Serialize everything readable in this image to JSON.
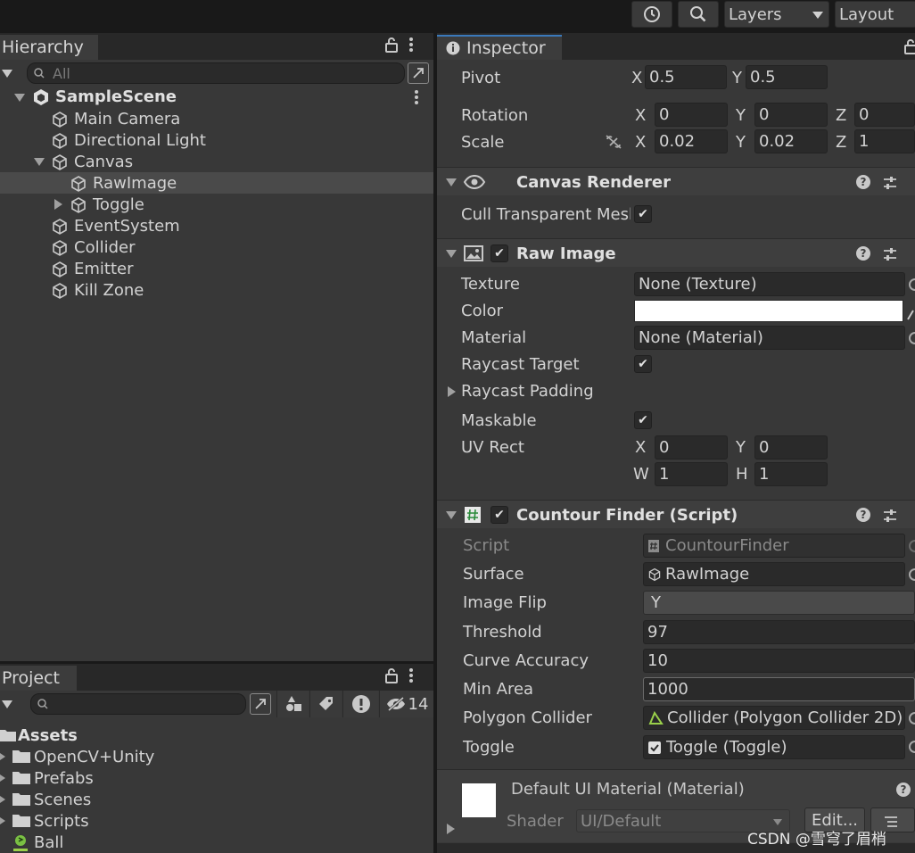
{
  "toolbar": {
    "layers_label": "Layers",
    "layout_label": "Layout"
  },
  "hierarchy": {
    "tab_label": "Hierarchy",
    "search_placeholder": "All",
    "scene_name": "SampleScene",
    "items": [
      {
        "label": "Main Camera"
      },
      {
        "label": "Directional Light"
      },
      {
        "label": "Canvas"
      },
      {
        "label": "RawImage"
      },
      {
        "label": "Toggle"
      },
      {
        "label": "EventSystem"
      },
      {
        "label": "Collider"
      },
      {
        "label": "Emitter"
      },
      {
        "label": "Kill Zone"
      }
    ]
  },
  "project": {
    "tab_label": "Project",
    "hidden_count": "14",
    "assets_label": "Assets",
    "folders": [
      {
        "label": "OpenCV+Unity"
      },
      {
        "label": "Prefabs"
      },
      {
        "label": "Scenes"
      },
      {
        "label": "Scripts"
      },
      {
        "label": "Ball"
      }
    ]
  },
  "inspector": {
    "tab_label": "Inspector",
    "transform": {
      "pivot_label": "Pivot",
      "pivot_x": "0.5",
      "pivot_y": "0.5",
      "rotation_label": "Rotation",
      "rot_x": "0",
      "rot_y": "0",
      "rot_z": "0",
      "scale_label": "Scale",
      "scale_x": "0.02",
      "scale_y": "0.02",
      "scale_z": "1",
      "axis_x": "X",
      "axis_y": "Y",
      "axis_z": "Z"
    },
    "canvas_renderer": {
      "title": "Canvas Renderer",
      "cull_label": "Cull Transparent Mesh"
    },
    "raw_image": {
      "title": "Raw Image",
      "texture_label": "Texture",
      "texture_value": "None (Texture)",
      "color_label": "Color",
      "color_value": "#ffffff",
      "material_label": "Material",
      "material_value": "None (Material)",
      "raycast_target_label": "Raycast Target",
      "raycast_padding_label": "Raycast Padding",
      "maskable_label": "Maskable",
      "uv_rect_label": "UV Rect",
      "uv_x": "0",
      "uv_y": "0",
      "uv_w": "1",
      "uv_h": "1",
      "axis_x": "X",
      "axis_y": "Y",
      "axis_w": "W",
      "axis_h": "H"
    },
    "contour_finder": {
      "title": "Countour Finder (Script)",
      "script_label": "Script",
      "script_value": "CountourFinder",
      "surface_label": "Surface",
      "surface_value": "RawImage",
      "image_flip_label": "Image Flip",
      "image_flip_value": "Y",
      "threshold_label": "Threshold",
      "threshold_value": "97",
      "curve_accuracy_label": "Curve Accuracy",
      "curve_accuracy_value": "10",
      "min_area_label": "Min Area",
      "min_area_value": "1000",
      "polygon_collider_label": "Polygon Collider",
      "polygon_collider_value": "Collider (Polygon Collider 2D)",
      "toggle_label": "Toggle",
      "toggle_value": "Toggle (Toggle)"
    },
    "material": {
      "title": "Default UI Material (Material)",
      "shader_label": "Shader",
      "shader_value": "UI/Default",
      "edit_label": "Edit..."
    }
  },
  "watermark": "CSDN @雪穹了眉梢"
}
